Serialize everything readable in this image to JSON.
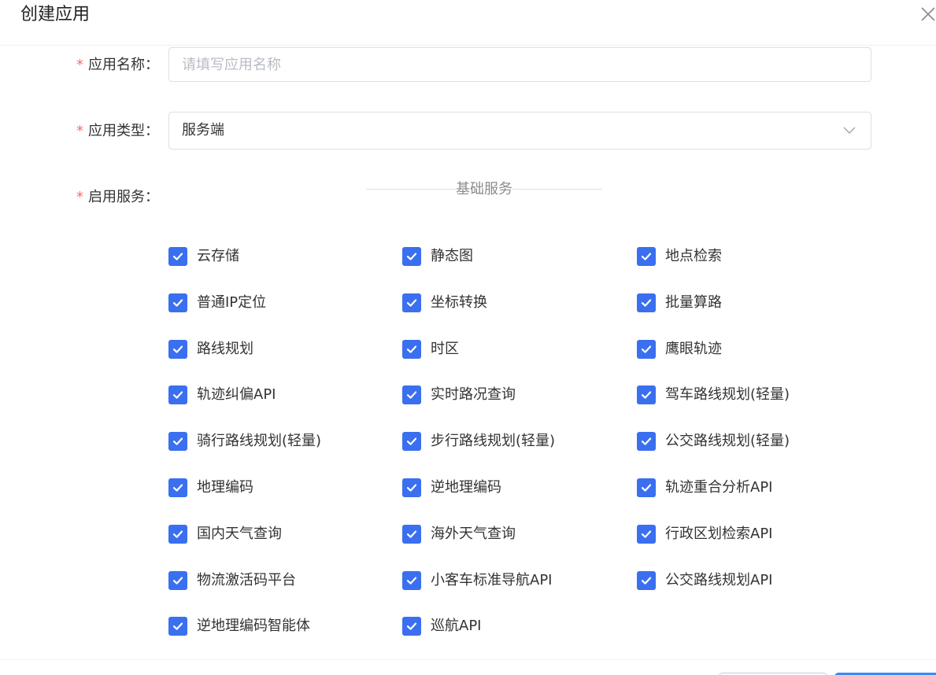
{
  "dialog": {
    "title": "创建应用",
    "close_icon": "close-icon"
  },
  "form": {
    "app_name": {
      "required_mark": "*",
      "label": "应用名称",
      "colon": "：",
      "placeholder": "请填写应用名称",
      "value": ""
    },
    "app_type": {
      "required_mark": "*",
      "label": "应用类型",
      "colon": "：",
      "value": "服务端",
      "arrow_icon": "chevron-down-icon"
    },
    "services": {
      "required_mark": "*",
      "label": "启用服务",
      "colon": "：",
      "section_title": "基础服务",
      "items": [
        {
          "label": "云存储",
          "checked": true
        },
        {
          "label": "静态图",
          "checked": true
        },
        {
          "label": "地点检索",
          "checked": true
        },
        {
          "label": "普通IP定位",
          "checked": true
        },
        {
          "label": "坐标转换",
          "checked": true
        },
        {
          "label": "批量算路",
          "checked": true
        },
        {
          "label": "路线规划",
          "checked": true
        },
        {
          "label": "时区",
          "checked": true
        },
        {
          "label": "鹰眼轨迹",
          "checked": true
        },
        {
          "label": "轨迹纠偏API",
          "checked": true
        },
        {
          "label": "实时路况查询",
          "checked": true
        },
        {
          "label": "驾车路线规划(轻量)",
          "checked": true
        },
        {
          "label": "骑行路线规划(轻量)",
          "checked": true
        },
        {
          "label": "步行路线规划(轻量)",
          "checked": true
        },
        {
          "label": "公交路线规划(轻量)",
          "checked": true
        },
        {
          "label": "地理编码",
          "checked": true
        },
        {
          "label": "逆地理编码",
          "checked": true
        },
        {
          "label": "轨迹重合分析API",
          "checked": true
        },
        {
          "label": "国内天气查询",
          "checked": true
        },
        {
          "label": "海外天气查询",
          "checked": true
        },
        {
          "label": "行政区划检索API",
          "checked": true
        },
        {
          "label": "物流激活码平台",
          "checked": true
        },
        {
          "label": "小客车标准导航API",
          "checked": true
        },
        {
          "label": "公交路线规划API",
          "checked": true
        },
        {
          "label": "逆地理编码智能体",
          "checked": true
        },
        {
          "label": "巡航API",
          "checked": true
        }
      ]
    }
  },
  "colors": {
    "accent": "#3a6ff0",
    "required": "#f56c6c",
    "primary_button": "#3a8bf5"
  }
}
